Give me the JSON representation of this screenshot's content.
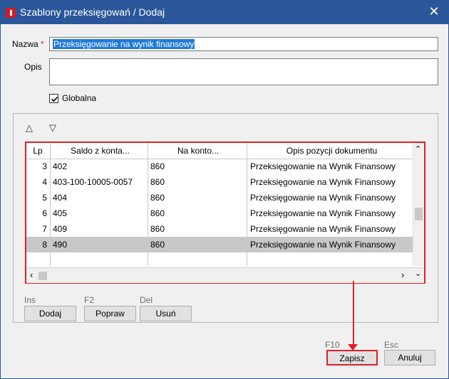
{
  "window": {
    "title": "Szablony przeksięgowań / Dodaj",
    "close_label": "✕"
  },
  "form": {
    "name_label": "Nazwa",
    "required_mark": "*",
    "name_value": "Przeksięgowanie na wynik finansowy",
    "description_label": "Opis",
    "description_value": "",
    "global_label": "Globalna",
    "global_checked": true
  },
  "toolbar": {
    "move_up_label": "△",
    "move_down_label": "▽"
  },
  "table": {
    "columns": [
      "Lp",
      "Saldo z konta...",
      "Na konto...",
      "Opis pozycji dokumentu"
    ],
    "rows": [
      {
        "lp": "3",
        "saldo": "402",
        "na": "860",
        "opis": "Przeksięgowanie na Wynik Finansowy"
      },
      {
        "lp": "4",
        "saldo": "403-100-10005-0057",
        "na": "860",
        "opis": "Przeksięgowanie na Wynik Finansowy"
      },
      {
        "lp": "5",
        "saldo": "404",
        "na": "860",
        "opis": "Przeksięgowanie na Wynik Finansowy"
      },
      {
        "lp": "6",
        "saldo": "405",
        "na": "860",
        "opis": "Przeksięgowanie na Wynik Finansowy"
      },
      {
        "lp": "7",
        "saldo": "409",
        "na": "860",
        "opis": "Przeksięgowanie na Wynik Finansowy"
      },
      {
        "lp": "8",
        "saldo": "490",
        "na": "860",
        "opis": "Przeksięgowanie na Wynik Finansowy"
      }
    ],
    "selected_row_lp": "8"
  },
  "row_actions": [
    {
      "key": "Ins",
      "label": "Dodaj"
    },
    {
      "key": "F2",
      "label": "Popraw"
    },
    {
      "key": "Del",
      "label": "Usuń"
    }
  ],
  "dialog_actions": [
    {
      "key": "F10",
      "label": "Zapisz"
    },
    {
      "key": "Esc",
      "label": "Anuluj"
    }
  ],
  "colors": {
    "titlebar": "#2b579a",
    "highlight": "#e21f26",
    "selection": "#1f7ad7"
  }
}
